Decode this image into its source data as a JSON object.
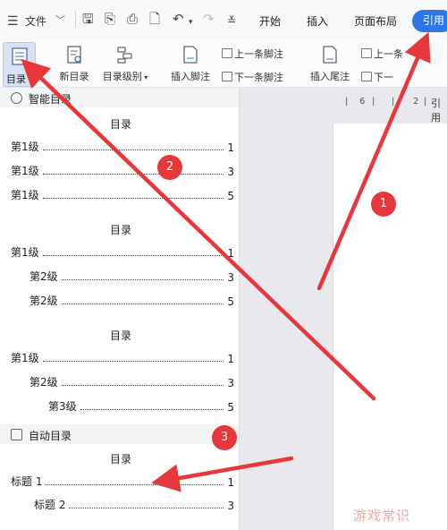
{
  "ribbon": {
    "menu_label": "文件",
    "tabs": [
      "开始",
      "插入",
      "页面布局",
      "引用"
    ]
  },
  "toolbar": {
    "toc_label": "目录",
    "update_toc_label": "新目录",
    "toc_level_label": "目录级别",
    "insert_footnote_label": "插入脚注",
    "prev_footnote_label": "上一条脚注",
    "next_footnote_label": "下一条脚注",
    "insert_endnote_label": "插入尾注",
    "prev_endnote_label": "上一条",
    "next_endnote_label": "下一"
  },
  "ruler": {
    "marks": [
      "6",
      "2",
      "引用"
    ]
  },
  "panel": {
    "smart_toc_header": "智能目录",
    "auto_toc_header": "自动目录",
    "smart_toc_templates": [
      {
        "title": "目录",
        "entries": [
          {
            "label": "第1级",
            "page": "1"
          },
          {
            "label": "第1级",
            "page": "3"
          },
          {
            "label": "第1级",
            "page": "5"
          }
        ]
      },
      {
        "title": "目录",
        "entries": [
          {
            "label": "第1级",
            "page": "1"
          },
          {
            "label": "第2级",
            "page": "3"
          },
          {
            "label": "第2级",
            "page": "5"
          }
        ]
      },
      {
        "title": "目录",
        "entries": [
          {
            "label": "第1级",
            "page": "1"
          },
          {
            "label": "第2级",
            "page": "3"
          },
          {
            "label": "第3级",
            "page": "5"
          }
        ]
      }
    ],
    "auto_toc_template": {
      "title": "目录",
      "entries": [
        {
          "label": "标题 1",
          "page": "1"
        },
        {
          "label": "标题 2",
          "page": "3"
        }
      ]
    }
  },
  "annotations": {
    "badge_1": "1",
    "badge_2": "2",
    "badge_3": "3",
    "arrow_color": "#e8373a"
  },
  "watermark": "游戏常识"
}
